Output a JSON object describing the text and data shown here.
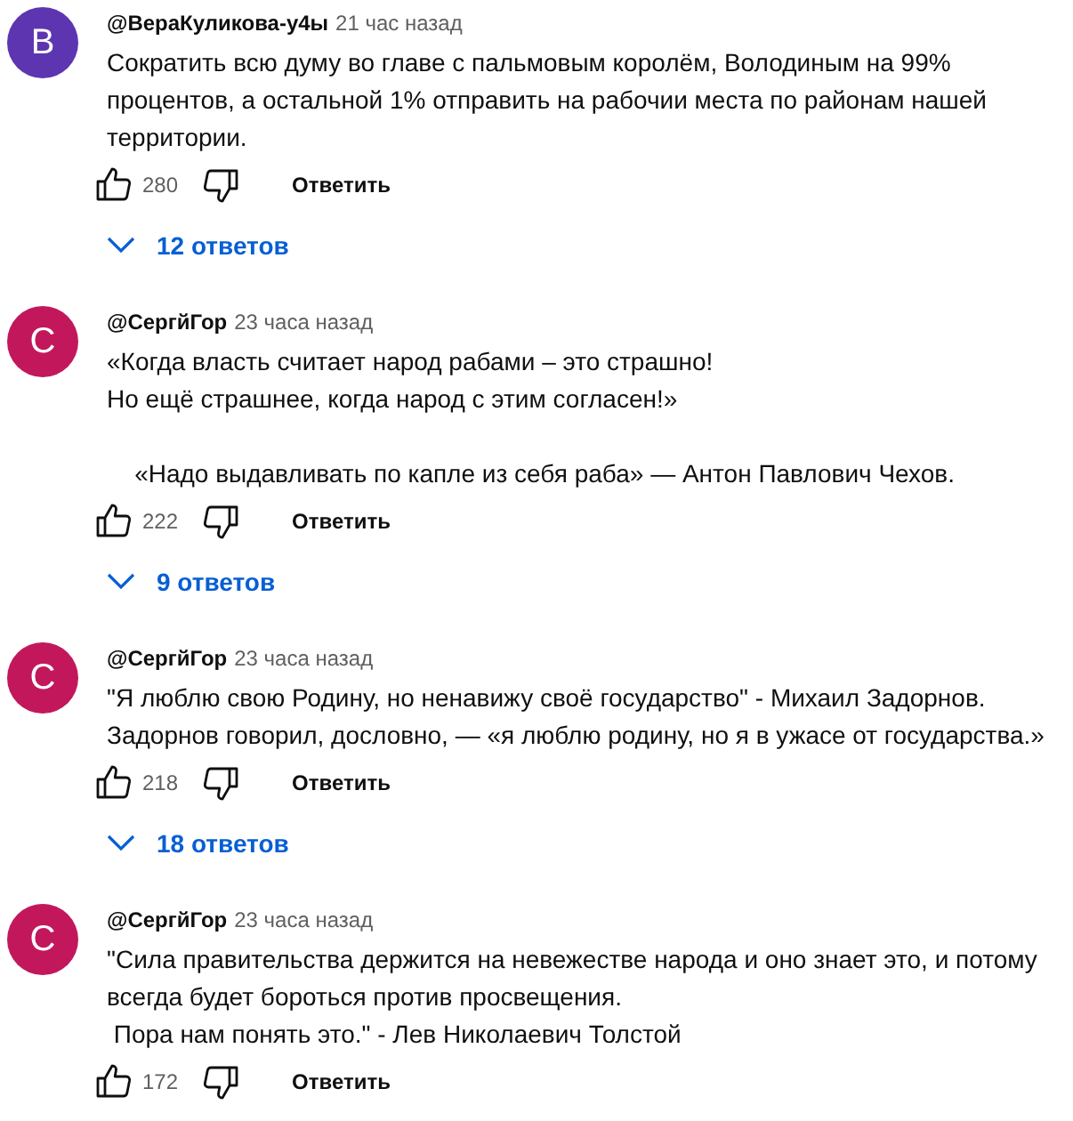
{
  "comments": [
    {
      "avatar_letter": "В",
      "color": "#5e35b1",
      "author": "@ВераКуликова-у4ы",
      "time": "21 час назад",
      "text": "Сократить всю думу во главе с пальмовым королём, Володиным на 99% процентов, а остальной 1% отправить на рабочии места по районам нашей территории.",
      "likes": "280",
      "reply_label": "Ответить",
      "replies": "12 ответов"
    },
    {
      "avatar_letter": "С",
      "color": "#c2185b",
      "author": "@СергйГор",
      "time": "23 часа назад",
      "text": "«Когда власть считает народ рабами – это страшно!\nНо ещё страшнее, когда народ с этим согласен!»\n\n    «Надо выдавливать по капле из себя раба» — Антон Павлович Чехов.",
      "likes": "222",
      "reply_label": "Ответить",
      "replies": "9 ответов"
    },
    {
      "avatar_letter": "С",
      "color": "#c2185b",
      "author": "@СергйГор",
      "time": "23 часа назад",
      "text": "\"Я люблю свою Родину, но ненавижу своё государство\" - Михаил Задорнов.\nЗадорнов говорил, дословно, — «я люблю родину, но я в ужасе от государства.»",
      "likes": "218",
      "reply_label": "Ответить",
      "replies": "18 ответов"
    },
    {
      "avatar_letter": "С",
      "color": "#c2185b",
      "author": "@СергйГор",
      "time": "23 часа назад",
      "text": "\"Сила правительства держится на невежестве народа и оно знает это, и потому всегда будет бороться против просвещения.\n Пора нам понять это.\" - Лев Николаевич Толстой",
      "likes": "172",
      "reply_label": "Ответить"
    }
  ]
}
